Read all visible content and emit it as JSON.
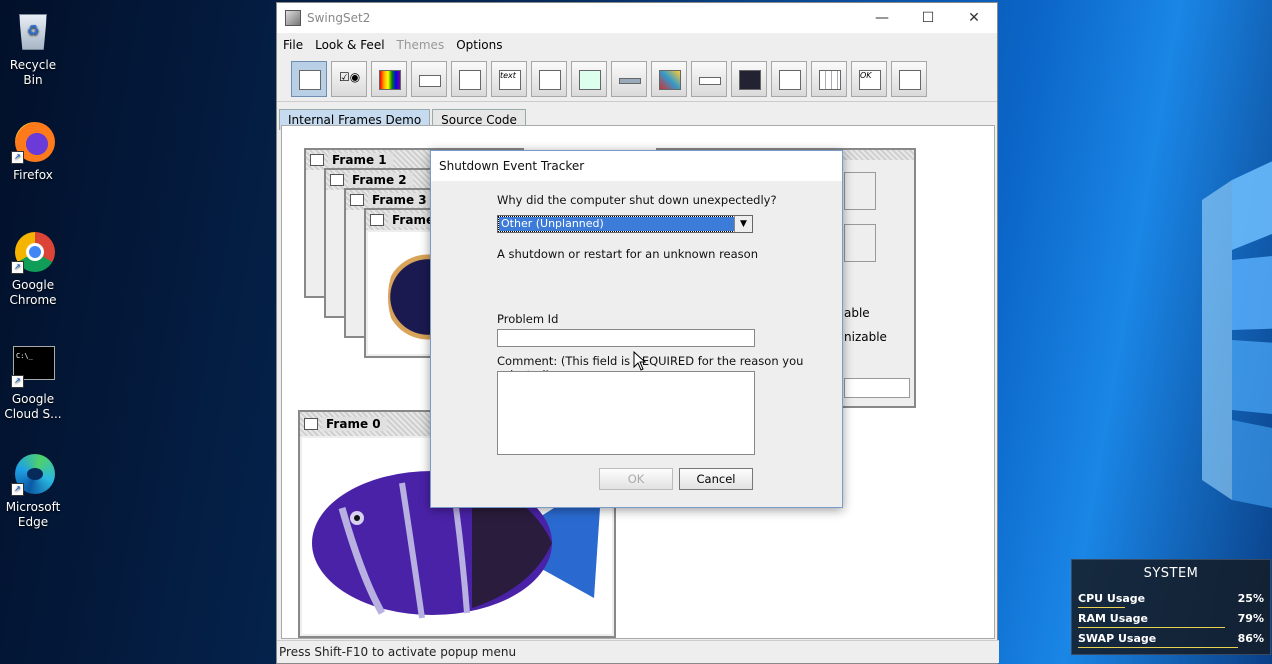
{
  "desktop": {
    "icons": [
      {
        "label": "Recycle Bin"
      },
      {
        "label": "Firefox"
      },
      {
        "label": "Google Chrome"
      },
      {
        "label": "Google Cloud S..."
      },
      {
        "label": "Microsoft Edge"
      }
    ]
  },
  "window": {
    "title": "SwingSet2",
    "menus": [
      "File",
      "Look & Feel",
      "Themes",
      "Options"
    ],
    "tabs": [
      "Internal Frames Demo",
      "Source Code"
    ],
    "status": "Press Shift-F10 to activate popup menu"
  },
  "frames": {
    "f0": "Frame 0",
    "f1": "Frame 1",
    "f2": "Frame 2",
    "f3": "Frame 3",
    "f4": "Frame",
    "side_labels": [
      "able",
      "nizable"
    ]
  },
  "dialog": {
    "title": "Shutdown Event Tracker",
    "question": "Why did the computer shut down unexpectedly?",
    "reason_selected": "Other (Unplanned)",
    "reason_desc": "A shutdown or restart for an unknown reason",
    "problem_id_label": "Problem Id",
    "problem_id_value": "",
    "comment_label": "Comment: (This field is REQUIRED for the reason you selected)",
    "comment_value": "",
    "ok_label": "OK",
    "cancel_label": "Cancel"
  },
  "system_widget": {
    "title": "SYSTEM",
    "rows": [
      {
        "name": "CPU Usage",
        "value": "25%",
        "fraction": 0.25
      },
      {
        "name": "RAM Usage",
        "value": "79%",
        "fraction": 0.79
      },
      {
        "name": "SWAP Usage",
        "value": "86%",
        "fraction": 0.86
      }
    ],
    "bar_color": "#e8d050"
  }
}
